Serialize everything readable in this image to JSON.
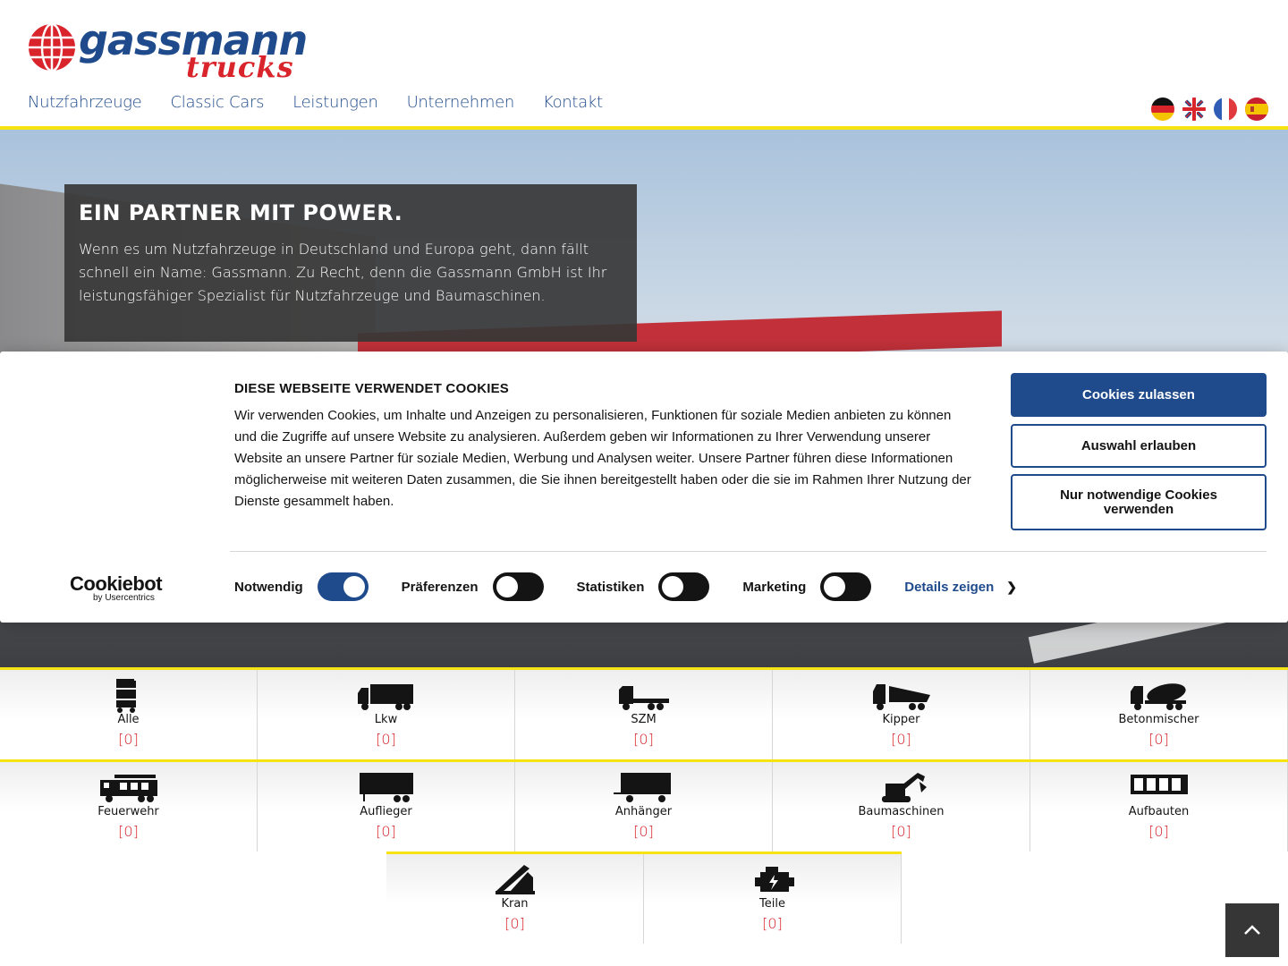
{
  "brand": {
    "name": "gassmann",
    "sub": "trucks",
    "primary_color": "#1f4b8c",
    "accent_color": "#d9242b",
    "highlight_color": "#f5e312"
  },
  "nav": [
    {
      "label": "Nutzfahrzeuge"
    },
    {
      "label": "Classic Cars"
    },
    {
      "label": "Leistungen"
    },
    {
      "label": "Unternehmen"
    },
    {
      "label": "Kontakt"
    }
  ],
  "languages": [
    "de-flag-icon",
    "uk-flag-icon",
    "fr-flag-icon",
    "es-flag-icon"
  ],
  "hero": {
    "title": "EIN PARTNER MIT POWER.",
    "text": "Wenn es um Nutzfahrzeuge in Deutschland und Europa geht, dann fällt schnell ein Name: Gassmann. Zu Recht, denn die Gassmann GmbH ist Ihr leistungsfähiger Spezialist für Nutzfahrzeuge und Baumaschinen."
  },
  "cookie": {
    "logo_name": "Cookiebot",
    "logo_by": "by Usercentrics",
    "title": "DIESE WEBSEITE VERWENDET COOKIES",
    "text": "Wir verwenden Cookies, um Inhalte und Anzeigen zu personalisieren, Funktionen für soziale Medien anbieten zu können und die Zugriffe auf unsere Website zu analysieren. Außerdem geben wir Informationen zu Ihrer Verwendung unserer Website an unsere Partner für soziale Medien, Werbung und Analysen weiter. Unsere Partner führen diese Informationen möglicherweise mit weiteren Daten zusammen, die Sie ihnen bereitgestellt haben oder die sie im Rahmen Ihrer Nutzung der Dienste gesammelt haben.",
    "toggles": [
      {
        "label": "Notwendig",
        "on": true
      },
      {
        "label": "Präferenzen",
        "on": false
      },
      {
        "label": "Statistiken",
        "on": false
      },
      {
        "label": "Marketing",
        "on": false
      }
    ],
    "details_label": "Details zeigen",
    "btn_allow_all": "Cookies zulassen",
    "btn_allow_selection": "Auswahl erlauben",
    "btn_necessary_only": "Nur notwendige Cookies verwenden"
  },
  "categories": [
    {
      "label": "Alle",
      "count": "[0]",
      "icon": "all-vehicles-icon"
    },
    {
      "label": "Lkw",
      "count": "[0]",
      "icon": "truck-icon"
    },
    {
      "label": "SZM",
      "count": "[0]",
      "icon": "tractor-unit-icon"
    },
    {
      "label": "Kipper",
      "count": "[0]",
      "icon": "tipper-icon"
    },
    {
      "label": "Betonmischer",
      "count": "[0]",
      "icon": "concrete-mixer-icon"
    },
    {
      "label": "Feuerwehr",
      "count": "[0]",
      "icon": "fire-truck-icon"
    },
    {
      "label": "Auflieger",
      "count": "[0]",
      "icon": "semi-trailer-icon"
    },
    {
      "label": "Anhänger",
      "count": "[0]",
      "icon": "trailer-icon"
    },
    {
      "label": "Baumaschinen",
      "count": "[0]",
      "icon": "excavator-icon"
    },
    {
      "label": "Aufbauten",
      "count": "[0]",
      "icon": "body-icon"
    },
    {
      "label": "Kran",
      "count": "[0]",
      "icon": "crane-icon"
    },
    {
      "label": "Teile",
      "count": "[0]",
      "icon": "engine-icon"
    }
  ]
}
